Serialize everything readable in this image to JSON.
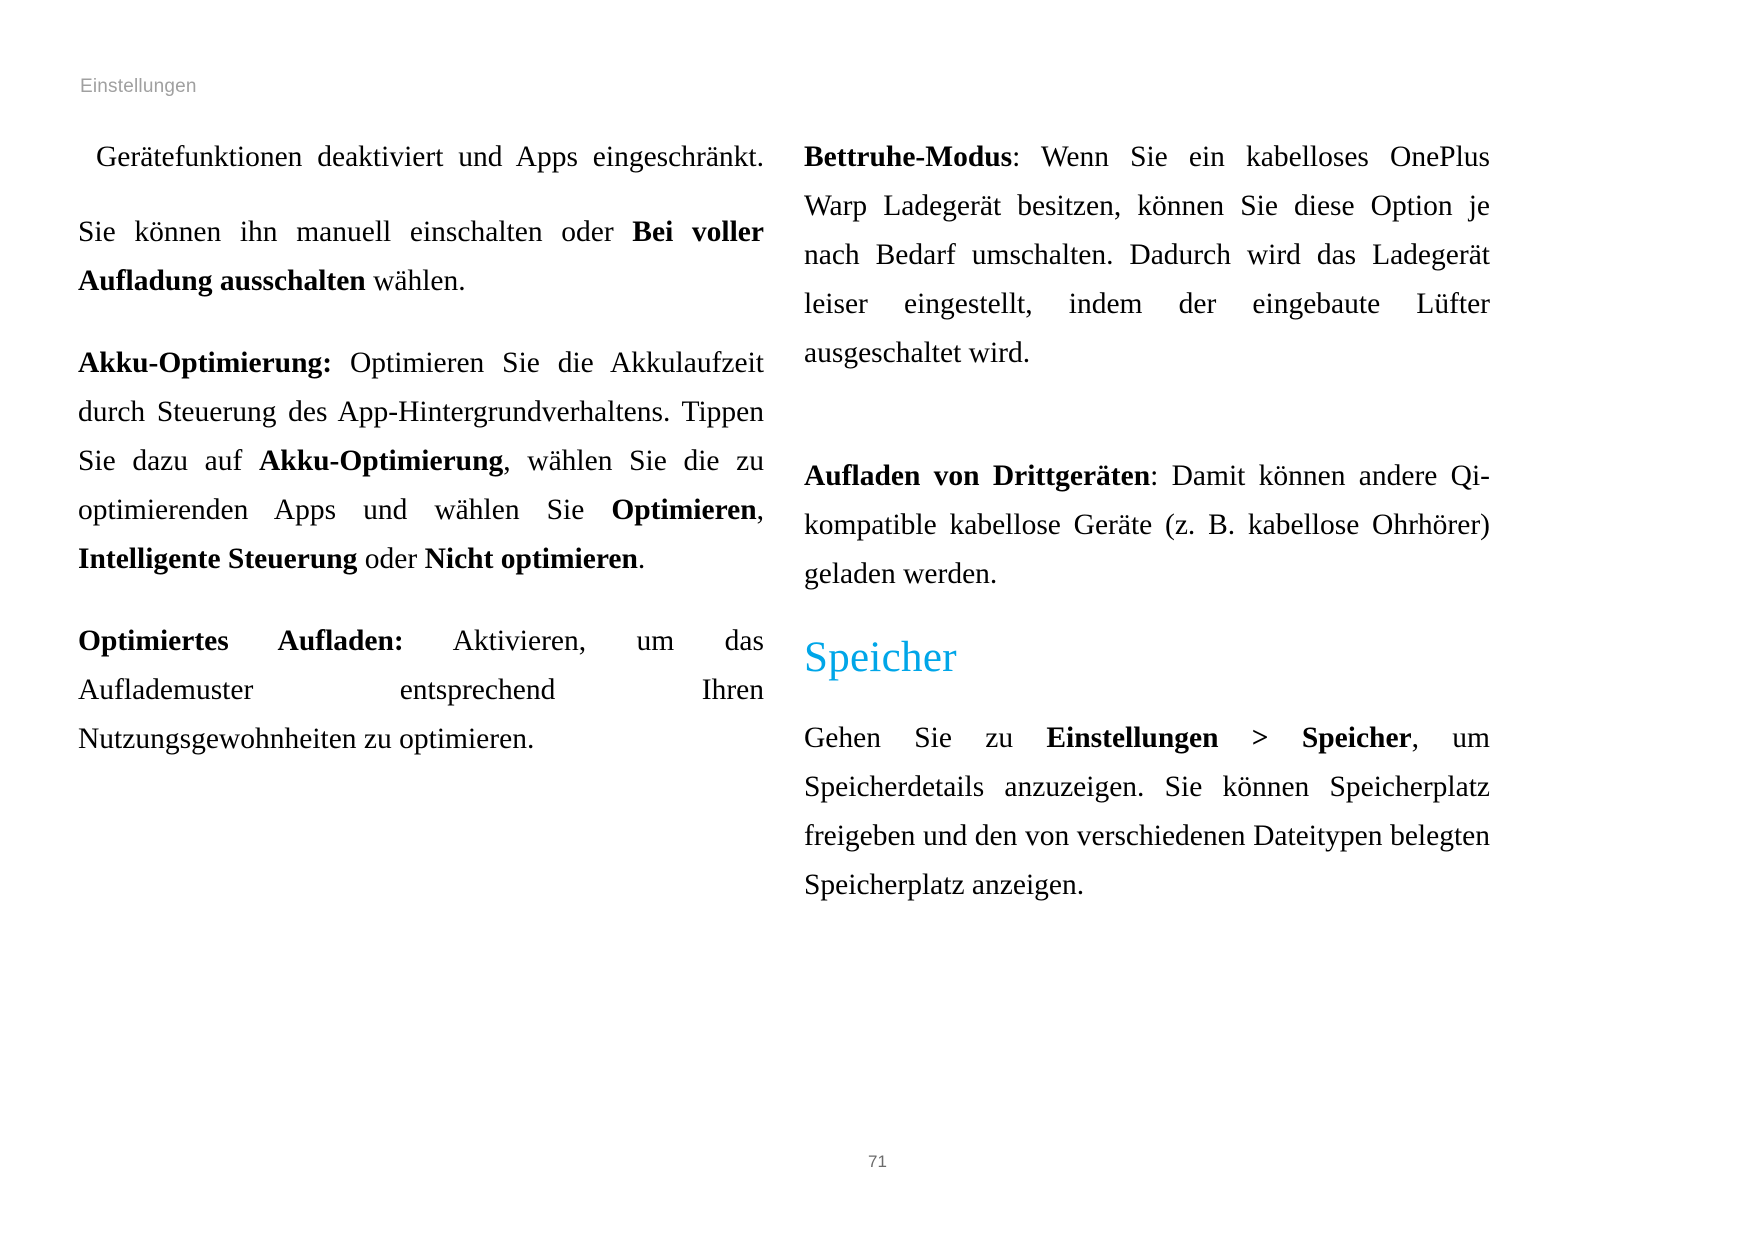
{
  "document": {
    "running_header": "Einstellungen",
    "page_number": "71",
    "accent_color": "#00a6e8",
    "header_color": "#a0a0a0"
  },
  "left_column": {
    "paragraphs": [
      {
        "id": "p-continued-device-functions",
        "kind": "continued",
        "runs": [
          {
            "text": "Gerätefunktionen deaktiviert und Apps eingeschränkt.",
            "bold": false
          }
        ]
      },
      {
        "id": "p-manual-toggle",
        "kind": "normal",
        "runs": [
          {
            "text": "Sie können ihn manuell einschalten oder ",
            "bold": false
          },
          {
            "text": "Bei voller Aufladung ausschalten",
            "bold": true
          },
          {
            "text": " wählen.",
            "bold": false
          }
        ]
      },
      {
        "id": "p-battery-optimization",
        "kind": "normal",
        "runs": [
          {
            "text": "Akku-Optimierung:",
            "bold": true
          },
          {
            "text": " Optimieren Sie die Akkulaufzeit durch Steuerung des App-Hintergrundverhaltens. Tippen Sie dazu auf ",
            "bold": false
          },
          {
            "text": "Akku-Optimierung",
            "bold": true
          },
          {
            "text": ", wählen Sie die zu optimierenden Apps und wählen Sie ",
            "bold": false
          },
          {
            "text": "Optimieren",
            "bold": true
          },
          {
            "text": ", ",
            "bold": false
          },
          {
            "text": "Intelligente Steuerung",
            "bold": true
          },
          {
            "text": " oder ",
            "bold": false
          },
          {
            "text": "Nicht optimieren",
            "bold": true
          },
          {
            "text": ".",
            "bold": false
          }
        ]
      },
      {
        "id": "p-optimized-charging",
        "kind": "normal",
        "runs": [
          {
            "text": "Optimiertes Aufladen:",
            "bold": true
          },
          {
            "text": " Aktivieren, um das Auflademuster entsprechend Ihren Nutzungsgewohnheiten zu optimieren.",
            "bold": false
          }
        ]
      }
    ]
  },
  "right_column": {
    "paragraphs": [
      {
        "id": "p-bedtime-mode",
        "kind": "normal",
        "runs": [
          {
            "text": "Bettruhe-Modus",
            "bold": true
          },
          {
            "text": ": Wenn Sie ein kabelloses OnePlus Warp Ladegerät besitzen, können Sie diese Option je nach Bedarf umschalten. Dadurch wird das Ladegerät leiser eingestellt, indem der eingebaute Lüfter ausgeschaltet wird.",
            "bold": false
          }
        ]
      },
      {
        "id": "p-third-party-charging",
        "kind": "normal",
        "runs": [
          {
            "text": "Aufladen von Drittgeräten",
            "bold": true
          },
          {
            "text": ": Damit können andere Qi-kompatible kabellose Geräte (z. B. kabellose Ohrhörer) geladen werden.",
            "bold": false
          }
        ]
      }
    ],
    "heading": "Speicher",
    "after_heading_paragraphs": [
      {
        "id": "p-storage-details",
        "kind": "normal",
        "runs": [
          {
            "text": "Gehen Sie zu ",
            "bold": false
          },
          {
            "text": "Einstellungen > Speicher",
            "bold": true
          },
          {
            "text": ", um Speicherdetails anzuzeigen. Sie können Speicherplatz freigeben und den von verschiedenen Dateitypen belegten Speicherplatz anzeigen.",
            "bold": false
          }
        ]
      }
    ]
  }
}
